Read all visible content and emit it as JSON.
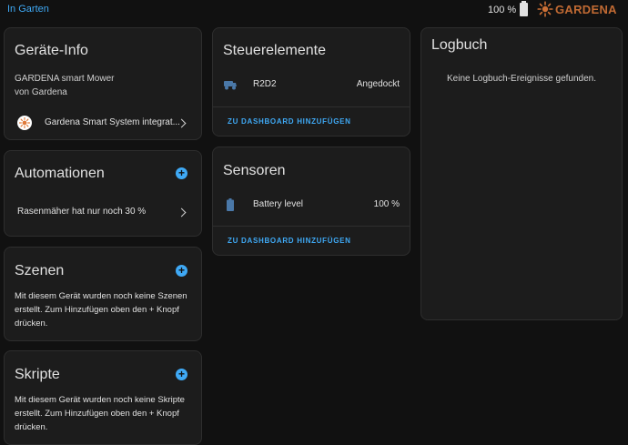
{
  "topbar": {
    "back_link": "In Garten",
    "battery_text": "100 %",
    "brand": "GARDENA"
  },
  "device_info": {
    "title": "Geräte-Info",
    "model": "GARDENA smart Mower",
    "manufacturer": "von Gardena",
    "integration_label": "Gardena Smart System integrat..."
  },
  "automations": {
    "title": "Automationen",
    "items": [
      {
        "label": "Rasenmäher hat nur noch 30 %"
      }
    ]
  },
  "scenes": {
    "title": "Szenen",
    "empty_text": "Mit diesem Gerät wurden noch keine Szenen erstellt. Zum Hinzufügen oben den + Knopf drücken."
  },
  "scripts": {
    "title": "Skripte",
    "empty_text": "Mit diesem Gerät wurden noch keine Skripte erstellt. Zum Hinzufügen oben den + Knopf drücken."
  },
  "controls": {
    "title": "Steuerelemente",
    "entity_name": "R2D2",
    "entity_state": "Angedockt",
    "add_link": "ZU DASHBOARD HINZUFÜGEN"
  },
  "sensors": {
    "title": "Sensoren",
    "entity_name": "Battery level",
    "entity_state": "100 %",
    "add_link": "ZU DASHBOARD HINZUFÜGEN"
  },
  "logbook": {
    "title": "Logbuch",
    "empty_text": "Keine Logbuch-Ereignisse gefunden."
  },
  "colors": {
    "accent": "#3fa9f5",
    "brand": "#e07a3a",
    "card": "#1c1c1c",
    "background": "#111111"
  },
  "icons": {
    "battery": "battery-full-icon",
    "brand": "gardena-logo-icon",
    "integration": "gardena-integration-icon",
    "mower": "robot-mower-icon",
    "sensor": "battery-level-icon",
    "add": "plus-circle-icon",
    "chevron": "chevron-right-icon"
  }
}
